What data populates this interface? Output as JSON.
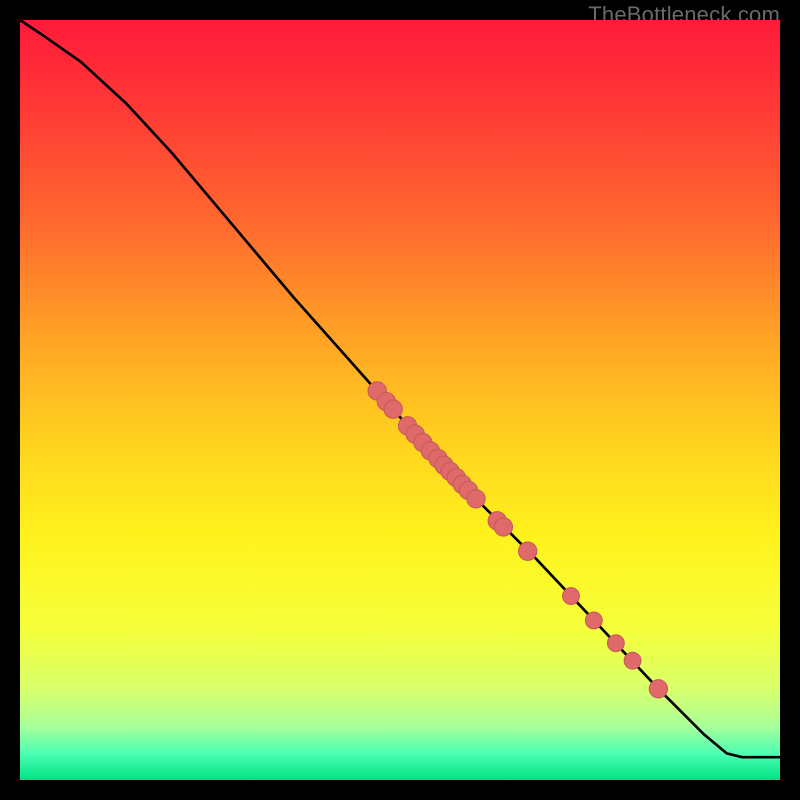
{
  "watermark": "TheBottleneck.com",
  "colors": {
    "bg": "#000000",
    "gradient_stops": [
      {
        "offset": 0.0,
        "color": "#ff1a3b"
      },
      {
        "offset": 0.12,
        "color": "#ff3a36"
      },
      {
        "offset": 0.28,
        "color": "#ff6d2e"
      },
      {
        "offset": 0.42,
        "color": "#ffa425"
      },
      {
        "offset": 0.56,
        "color": "#ffd41f"
      },
      {
        "offset": 0.68,
        "color": "#fff21c"
      },
      {
        "offset": 0.8,
        "color": "#f6ff3a"
      },
      {
        "offset": 0.88,
        "color": "#d8ff6b"
      },
      {
        "offset": 0.93,
        "color": "#a7ff9a"
      },
      {
        "offset": 0.965,
        "color": "#4dffb3"
      },
      {
        "offset": 1.0,
        "color": "#00e383"
      }
    ],
    "curve": "#000000",
    "dot_fill": "#e06a6a",
    "dot_stroke": "#c85a5a"
  },
  "chart_data": {
    "type": "line",
    "title": "",
    "xlabel": "",
    "ylabel": "",
    "xlim": [
      0,
      100
    ],
    "ylim": [
      0,
      100
    ],
    "grid": false,
    "curve": [
      {
        "x": 0,
        "y": 100
      },
      {
        "x": 3,
        "y": 98
      },
      {
        "x": 8,
        "y": 94.5
      },
      {
        "x": 14,
        "y": 89
      },
      {
        "x": 20,
        "y": 82.5
      },
      {
        "x": 28,
        "y": 73
      },
      {
        "x": 36,
        "y": 63.5
      },
      {
        "x": 44,
        "y": 54.5
      },
      {
        "x": 52,
        "y": 45.5
      },
      {
        "x": 60,
        "y": 37
      },
      {
        "x": 68,
        "y": 29
      },
      {
        "x": 76,
        "y": 20.5
      },
      {
        "x": 84,
        "y": 12
      },
      {
        "x": 90,
        "y": 6
      },
      {
        "x": 93,
        "y": 3.5
      },
      {
        "x": 95,
        "y": 3
      },
      {
        "x": 100,
        "y": 3
      }
    ],
    "dots": [
      {
        "x": 47.0,
        "y": 51.2,
        "r": 1.2
      },
      {
        "x": 48.2,
        "y": 49.8,
        "r": 1.2
      },
      {
        "x": 49.1,
        "y": 48.8,
        "r": 1.2
      },
      {
        "x": 51.0,
        "y": 46.6,
        "r": 1.2
      },
      {
        "x": 52.0,
        "y": 45.5,
        "r": 1.2
      },
      {
        "x": 53.0,
        "y": 44.4,
        "r": 1.2
      },
      {
        "x": 54.0,
        "y": 43.3,
        "r": 1.2
      },
      {
        "x": 55.0,
        "y": 42.3,
        "r": 1.2
      },
      {
        "x": 55.8,
        "y": 41.4,
        "r": 1.2
      },
      {
        "x": 56.6,
        "y": 40.6,
        "r": 1.2
      },
      {
        "x": 57.4,
        "y": 39.8,
        "r": 1.2
      },
      {
        "x": 58.2,
        "y": 38.9,
        "r": 1.2
      },
      {
        "x": 59.0,
        "y": 38.1,
        "r": 1.2
      },
      {
        "x": 60.0,
        "y": 37.0,
        "r": 1.2
      },
      {
        "x": 62.8,
        "y": 34.1,
        "r": 1.2
      },
      {
        "x": 63.6,
        "y": 33.3,
        "r": 1.2
      },
      {
        "x": 66.8,
        "y": 30.1,
        "r": 1.2
      },
      {
        "x": 72.5,
        "y": 24.2,
        "r": 1.1
      },
      {
        "x": 75.5,
        "y": 21.0,
        "r": 1.1
      },
      {
        "x": 78.4,
        "y": 18.0,
        "r": 1.1
      },
      {
        "x": 80.6,
        "y": 15.7,
        "r": 1.1
      },
      {
        "x": 84.0,
        "y": 12.0,
        "r": 1.2
      }
    ]
  }
}
